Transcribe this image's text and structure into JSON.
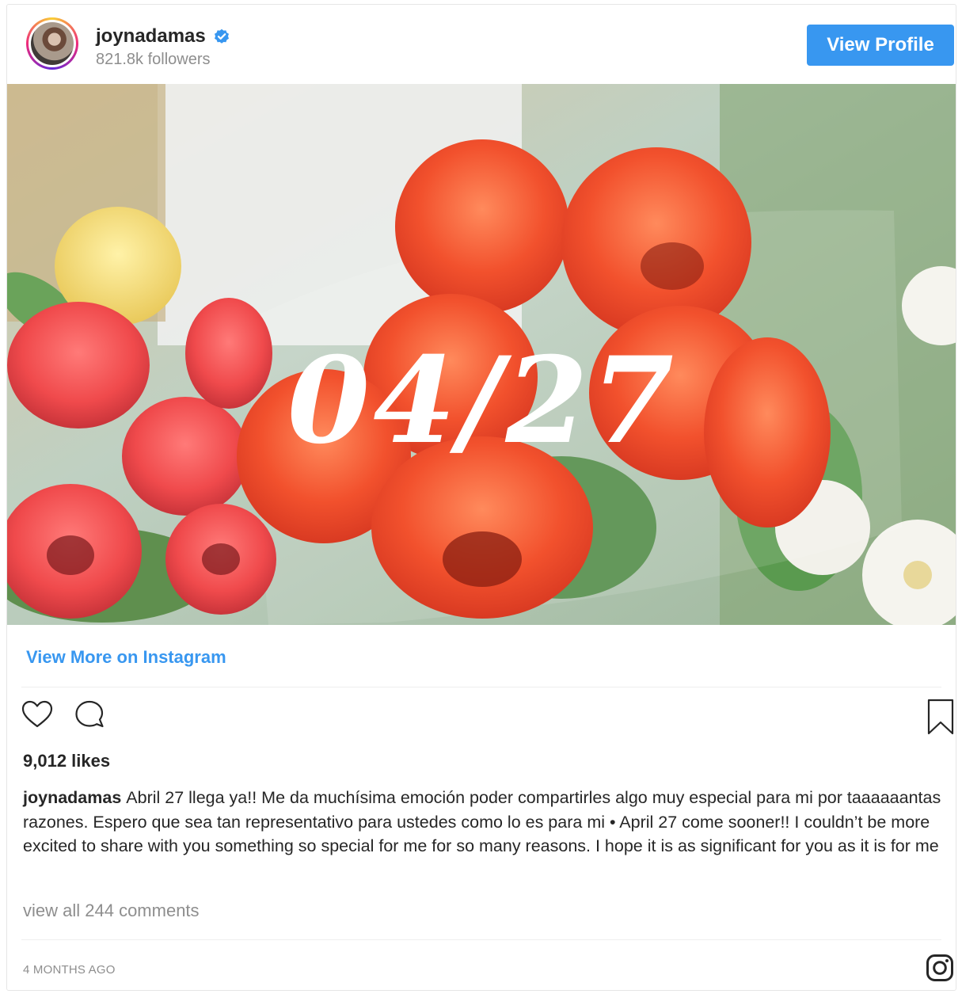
{
  "header": {
    "username": "joynadamas",
    "followers": "821.8k followers",
    "view_profile_label": "View Profile",
    "verified_color": "#3897f0"
  },
  "post": {
    "image_overlay_text": "04/27",
    "view_more_label": "View More on Instagram",
    "likes": "9,012 likes",
    "caption_user": "joynadamas",
    "caption_text": "Abril 27 llega ya!! Me da muchísima emoción poder compartirles algo muy especial para mi por taaaaaantas razones. Espero que sea tan representativo para ustedes como lo es para mi • April 27 come sooner!! I couldn’t be more excited to share with you something so special for me for so many reasons. I hope it is as significant for you as it is for me",
    "comments_link": "view all 244 comments",
    "timestamp": "4 MONTHS AGO"
  },
  "icons": {
    "like": "heart-icon",
    "comment": "comment-icon",
    "save": "bookmark-icon",
    "brand": "instagram-icon"
  },
  "colors": {
    "accent": "#3897f0",
    "muted": "#8e8e8e",
    "text": "#262626"
  }
}
